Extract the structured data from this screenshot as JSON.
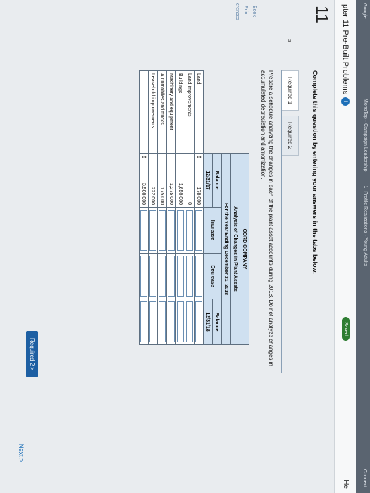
{
  "browser": {
    "tabs": [
      "MonoTap - Campaign Leadership",
      "1. Profile Realizations - Young Adults",
      "Connect"
    ],
    "left_label": "Google"
  },
  "header": {
    "title": "pter 11 Pre-Built Problems",
    "info_icon": "i",
    "saved": "Saved",
    "help": "He"
  },
  "rail": {
    "question_number": "11",
    "links": [
      "Book",
      "Print",
      "erences"
    ],
    "side_mark": "s"
  },
  "instruction": "Complete this question by entering your answers in the tabs below.",
  "tabs": [
    "Required 1",
    "Required 2"
  ],
  "prompt": "Prepare a schedule analyzing the changes in each of the plant asset accounts during 2018. Do not analyze changes in accumulated depreciation and amortization.",
  "schedule": {
    "company": "CORD COMPANY",
    "title": "Analysis of Changes in Plant Assets",
    "period": "For the Year Ending December 31, 2018",
    "col_balance_open_1": "Balance",
    "col_balance_open_2": "12/31/17",
    "col_increase": "Increase",
    "col_decrease": "Decrease",
    "col_balance_close_1": "Balance",
    "col_balance_close_2": "12/31/18",
    "rows": [
      {
        "label": "Land",
        "cur": "$",
        "balance": "178,000"
      },
      {
        "label": "Land improvements",
        "cur": "",
        "balance": "0"
      },
      {
        "label": "Buildings",
        "cur": "",
        "balance": "1,650,000"
      },
      {
        "label": "Machinery and equipment",
        "cur": "",
        "balance": "1,275,000"
      },
      {
        "label": "Automobiles and trucks",
        "cur": "",
        "balance": "175,000"
      },
      {
        "label": "Leasehold improvements",
        "cur": "",
        "balance": "222,000"
      }
    ],
    "total": {
      "cur": "$",
      "balance": "3,500,000"
    }
  },
  "nav": {
    "required2_button": "Required 2  >",
    "next": "Next  >"
  }
}
